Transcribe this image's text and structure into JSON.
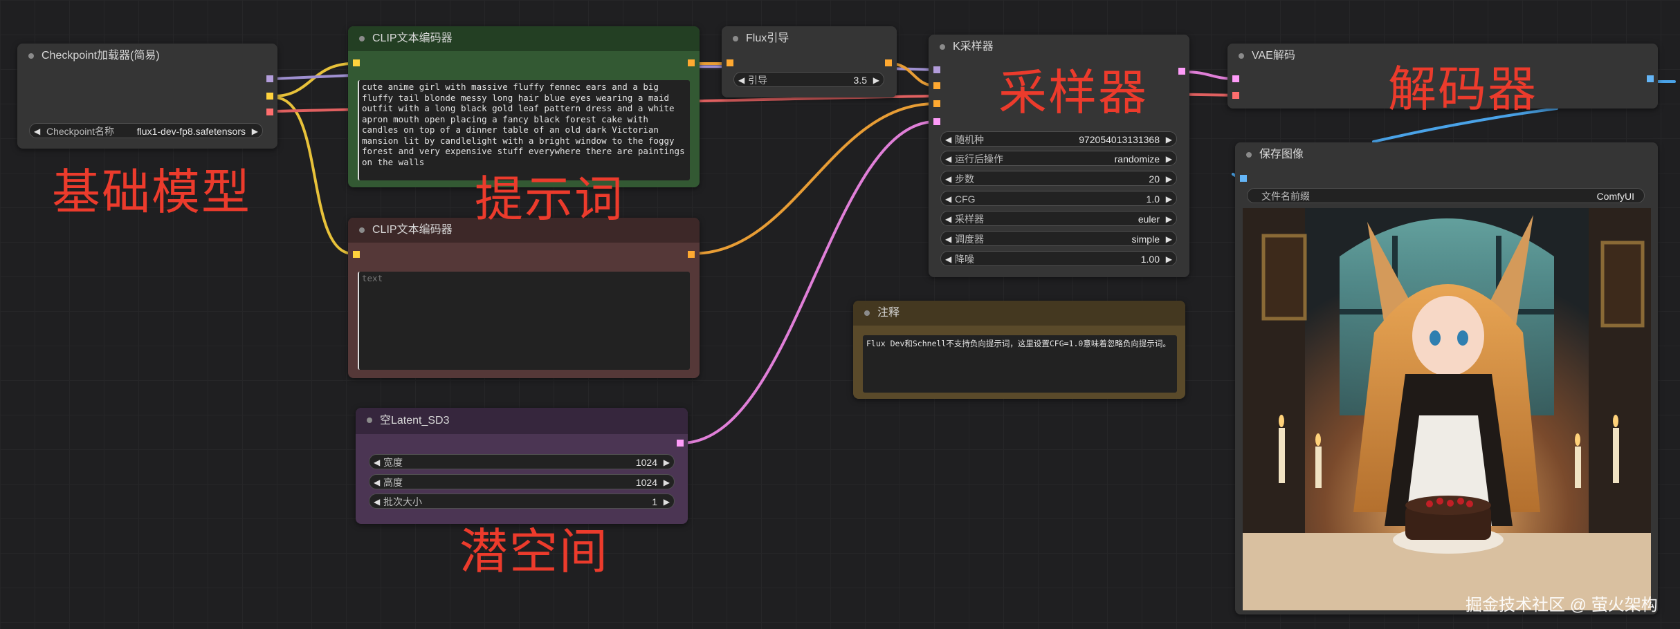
{
  "nodes": {
    "checkpoint": {
      "title": "Checkpoint加载器(简易)",
      "widget_label": "Checkpoint名称",
      "widget_value": "flux1-dev-fp8.safetensors"
    },
    "clip_pos": {
      "title": "CLIP文本编码器",
      "text": "cute anime girl with massive fluffy fennec ears and a big fluffy tail blonde messy long hair blue eyes wearing a maid outfit with a long black gold leaf pattern dress and a white apron mouth open placing a fancy black forest cake with candles on top of a dinner table of an old dark Victorian mansion lit by candlelight with a bright window to the foggy forest and very expensive stuff everywhere there are paintings on the walls"
    },
    "clip_neg": {
      "title": "CLIP文本编码器",
      "placeholder": "text"
    },
    "flux_guidance": {
      "title": "Flux引导",
      "label": "引导",
      "value": "3.5"
    },
    "ksampler": {
      "title": "K采样器",
      "widgets": [
        {
          "label": "随机种",
          "value": "972054013131368"
        },
        {
          "label": "运行后操作",
          "value": "randomize"
        },
        {
          "label": "步数",
          "value": "20"
        },
        {
          "label": "CFG",
          "value": "1.0"
        },
        {
          "label": "采样器",
          "value": "euler"
        },
        {
          "label": "调度器",
          "value": "simple"
        },
        {
          "label": "降噪",
          "value": "1.00"
        }
      ]
    },
    "vae_decode": {
      "title": "VAE解码"
    },
    "save_image": {
      "title": "保存图像",
      "prefix_label": "文件名前缀",
      "prefix_value": "ComfyUI"
    },
    "note": {
      "title": "注释",
      "text": "Flux Dev和Schnell不支持负向提示词，这里设置CFG=1.0意味着忽略负向提示词。"
    },
    "latent": {
      "title": "空Latent_SD3",
      "widgets": [
        {
          "label": "宽度",
          "value": "1024"
        },
        {
          "label": "高度",
          "value": "1024"
        },
        {
          "label": "批次大小",
          "value": "1"
        }
      ]
    }
  },
  "overlays": {
    "base_model": "基础模型",
    "prompt": "提示词",
    "sampler": "采样器",
    "decoder": "解码器",
    "latent_space": "潜空间"
  },
  "watermark": "掘金技术社区 @ 萤火架构",
  "colors": {
    "overlay_red": "#ec3b2c",
    "wire_clip": "#ffd33d",
    "wire_model": "#b39ddb",
    "wire_vae": "#ff6e6e",
    "wire_conditioning": "#ffa931",
    "wire_latent": "#ff9cf9",
    "wire_image": "#64b5f6"
  }
}
